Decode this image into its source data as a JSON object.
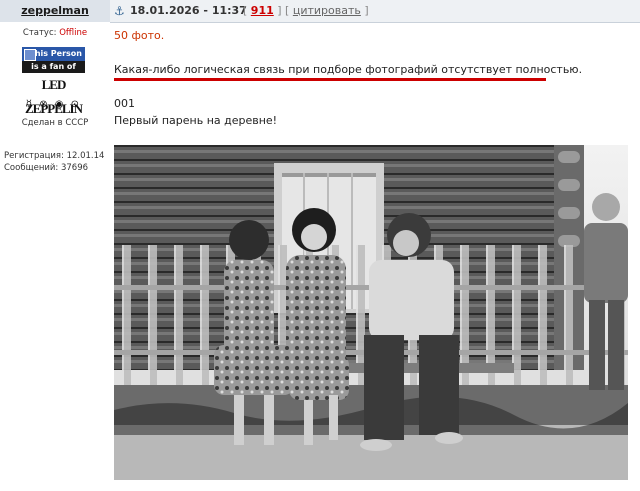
{
  "header": {
    "username": "zeppelman",
    "post_date": "18.01.2026 - 11:37",
    "link_num": "911",
    "cite_label": "цитировать",
    "open_bracket": "[",
    "mid_sep": "] [",
    "close_bracket": "]"
  },
  "sidebar": {
    "status_label": "Статус:",
    "status_value": "Offline",
    "badge_top": "This Person",
    "badge_mid": "is a fan of",
    "badge_logo": "LED ZEPPELIN",
    "signature": "Сделан в СССР",
    "reg_line": "Регистрация: 12.01.14",
    "posts_line": "Сообщений: 37696"
  },
  "content": {
    "photos_count": "50 фото.",
    "note": "Какая-либо логическая связь при подборе фотографий отсутствует полностью.",
    "photo_number": "001",
    "caption": "Первый парень на деревне!"
  },
  "colors": {
    "header_bg": "#dde3ea",
    "offline": "#cc0000",
    "underline_red": "#cc0000",
    "count_orange": "#cc3300"
  }
}
